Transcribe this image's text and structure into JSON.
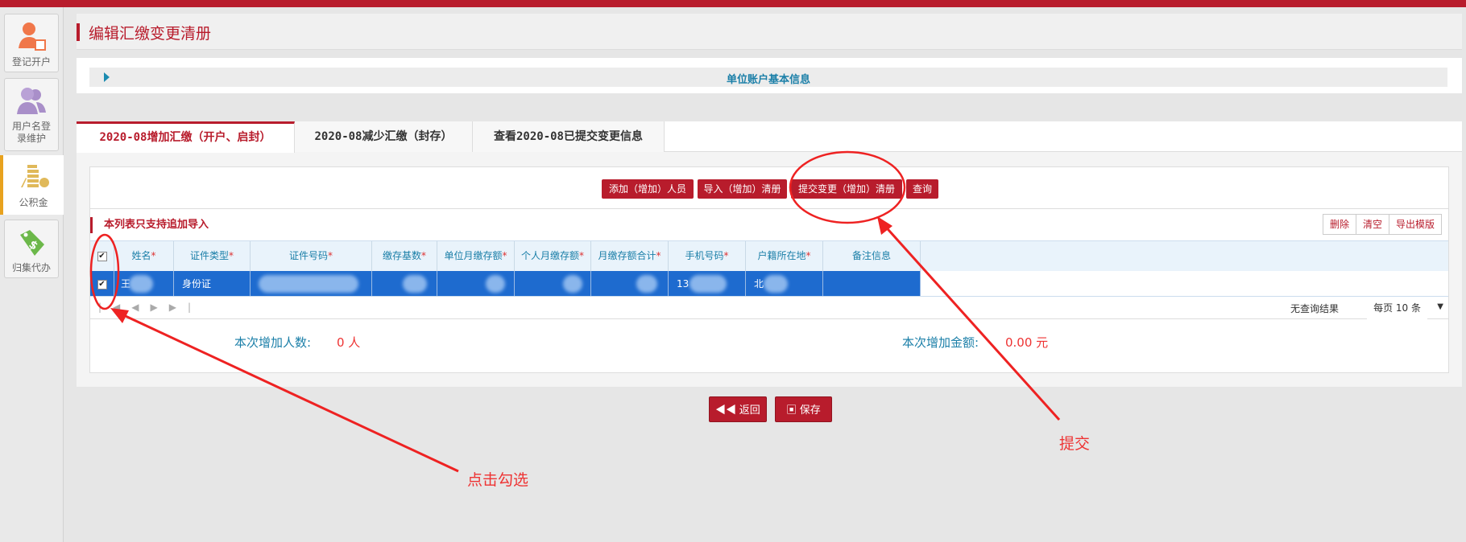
{
  "sidebar": {
    "items": [
      {
        "label": "登记开户"
      },
      {
        "label": "用户名登录维护"
      },
      {
        "label": "公积金"
      },
      {
        "label": "归集代办"
      }
    ]
  },
  "page_title": "编辑汇缴变更清册",
  "info_bar": "单位账户基本信息",
  "tabs": [
    {
      "label": "2020-08增加汇缴（开户、启封）"
    },
    {
      "label": "2020-08减少汇缴（封存）"
    },
    {
      "label": "查看2020-08已提交变更信息"
    }
  ],
  "toolbar": {
    "add": "添加（增加）人员",
    "import": "导入（增加）清册",
    "submit": "提交变更（增加）清册",
    "query": "查询"
  },
  "notice": "本列表只支持追加导入",
  "table_actions": {
    "delete": "删除",
    "clear": "清空",
    "export": "导出模版"
  },
  "columns": [
    "姓名",
    "证件类型",
    "证件号码",
    "缴存基数",
    "单位月缴存额",
    "个人月缴存额",
    "月缴存额合计",
    "手机号码",
    "户籍所在地",
    "备注信息"
  ],
  "row": {
    "id_type": "身份证",
    "phone_prefix": "13",
    "name_prefix": "王",
    "hukou_prefix": "北"
  },
  "pager": {
    "no_results": "无查询结果",
    "per_page": "每页 10 条"
  },
  "summary": {
    "count_label": "本次增加人数:",
    "count_value": "0 人",
    "amount_label": "本次增加金额:",
    "amount_value": "0.00 元"
  },
  "buttons": {
    "back": "返回",
    "save": "保存"
  },
  "annotations": {
    "check": "点击勾选",
    "submit": "提交"
  }
}
